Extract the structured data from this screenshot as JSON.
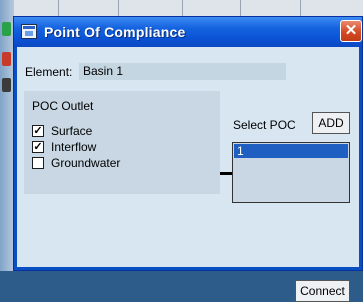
{
  "dialog": {
    "title": "Point Of Compliance",
    "close_glyph": "✕",
    "icon": "window-icon"
  },
  "element": {
    "label": "Element:",
    "value": "Basin 1"
  },
  "poc_outlet": {
    "label": "POC Outlet",
    "options": [
      {
        "label": "Surface",
        "checked": true
      },
      {
        "label": "Interflow",
        "checked": true
      },
      {
        "label": "Groundwater",
        "checked": false
      }
    ]
  },
  "select_poc": {
    "label": "Select POC",
    "add_label": "ADD",
    "items": [
      "1"
    ],
    "selected_index": 0
  },
  "actions": {
    "connect_label": "Connect"
  },
  "colors": {
    "titlebar": "#0a54d6",
    "client_bg": "#d7e6f1",
    "selection": "#1f5fc1",
    "close_button": "#d44a23"
  }
}
